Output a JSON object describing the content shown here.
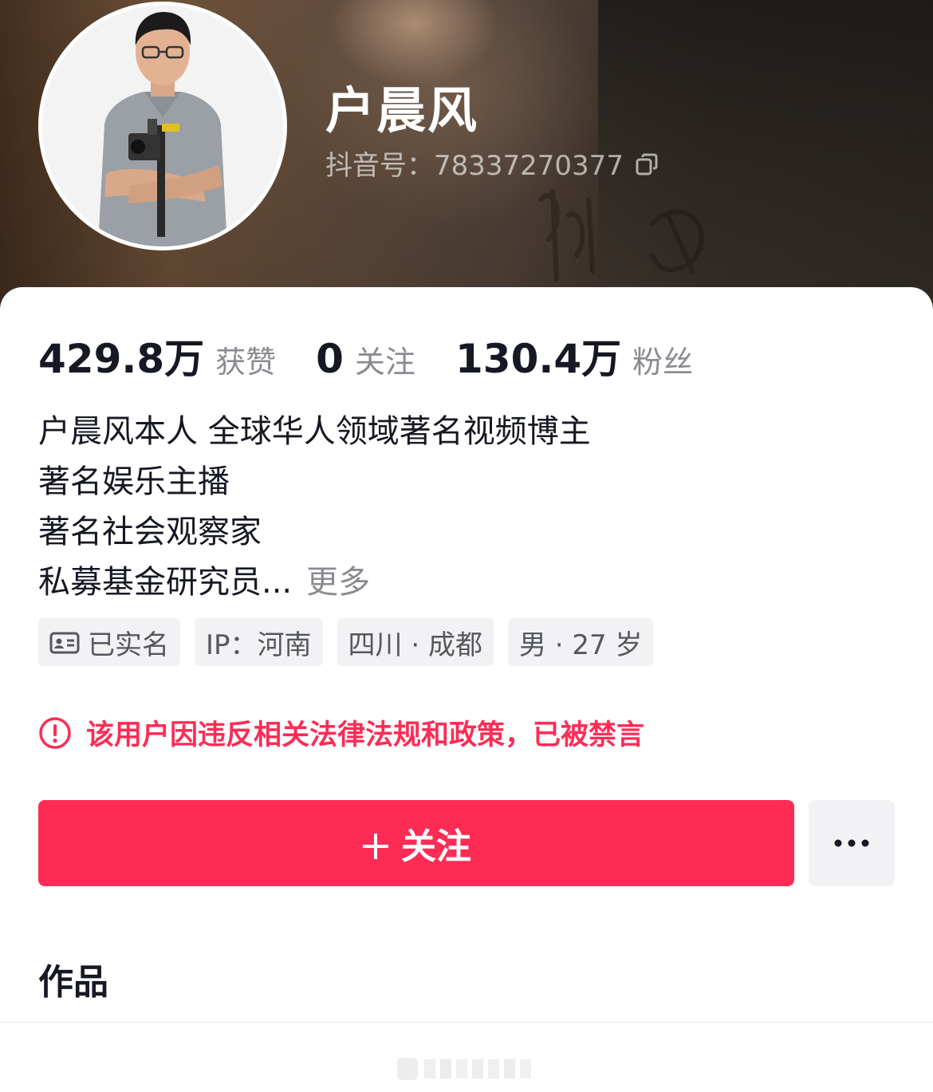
{
  "profile": {
    "nickname": "户晨风",
    "douyin_id": "抖音号：78337270377"
  },
  "stats": [
    {
      "value": "429.8万",
      "label": "获赞"
    },
    {
      "value": "0",
      "label": "关注"
    },
    {
      "value": "130.4万",
      "label": "粉丝"
    }
  ],
  "bio": {
    "lines": [
      "户晨风本人  全球华人领域著名视频博主",
      "著名娱乐主播",
      "著名社会观察家",
      "私募基金研究员..."
    ],
    "more_label": "更多"
  },
  "tags": {
    "verified": "已实名",
    "ip": "IP：河南",
    "location": "四川 · 成都",
    "gender_age": "男 · 27 岁"
  },
  "notice": {
    "text": "该用户因违反相关法律法规和政策，已被禁言",
    "color": "#fe2c55"
  },
  "actions": {
    "follow_label": "关注",
    "follow_color": "#fe2c55"
  },
  "tabs": {
    "works_label": "作品"
  },
  "icons": {
    "copy": "copy-icon",
    "verified": "id-card-icon",
    "warning": "exclamation-circle-icon",
    "follow": "plus-icon",
    "more": "ellipsis-icon"
  }
}
